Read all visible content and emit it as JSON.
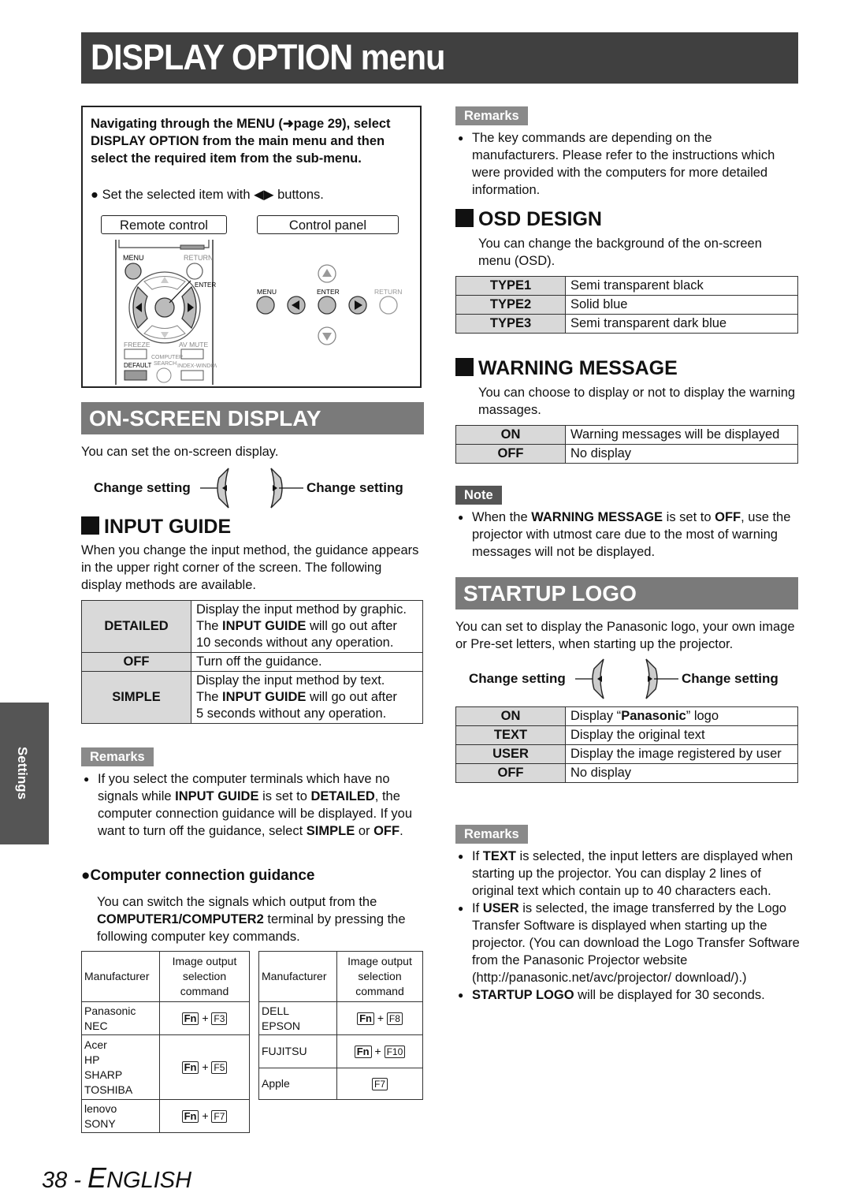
{
  "page_title": "DISPLAY OPTION menu",
  "side_tab": "Settings",
  "nav_box": {
    "instruction": "Navigating through the MENU (➜page 29), select DISPLAY OPTION from the main menu and then select the required item from the sub-menu.",
    "bullet": "Set the selected item with ◀▶ buttons.",
    "remote_label": "Remote control",
    "panel_label": "Control panel",
    "remote_buttons": [
      "MENU",
      "RETURN",
      "ENTER",
      "FREEZE",
      "AV MUTE",
      "COMPUTER SEARCH",
      "DEFAULT",
      "INDEX-WINDOW"
    ],
    "panel_buttons": [
      "MENU",
      "ENTER",
      "RETURN"
    ]
  },
  "on_screen_display": {
    "heading": "ON-SCREEN DISPLAY",
    "intro": "You can set the on-screen display.",
    "change_left": "Change setting",
    "change_right": "Change setting"
  },
  "input_guide": {
    "heading": "INPUT GUIDE",
    "intro": "When you change the input method, the guidance appears in the upper right corner of the screen. The following display methods are available.",
    "rows": [
      {
        "key": "DETAILED",
        "lines": [
          "Display the input method by graphic.",
          "The INPUT GUIDE will go out after",
          "10 seconds without any operation."
        ]
      },
      {
        "key": "OFF",
        "lines": [
          "Turn off the guidance."
        ]
      },
      {
        "key": "SIMPLE",
        "lines": [
          "Display the input method by text.",
          "The INPUT GUIDE will go out after",
          "5 seconds without any operation."
        ]
      }
    ],
    "remarks_label": "Remarks",
    "remarks": "If you select the computer terminals which have no signals while INPUT GUIDE is set to DETAILED, the computer connection guidance will be displayed. If you want to turn off the guidance, select SIMPLE or OFF."
  },
  "computer_guidance": {
    "heading": "Computer connection guidance",
    "intro_a": "You can switch the signals which output from the ",
    "intro_b": "COMPUTER1/COMPUTER2",
    "intro_c": " terminal by pressing the following computer key commands.",
    "col_manufacturer": "Manufacturer",
    "col_command": "Image output selection command",
    "left_table": [
      {
        "makers": [
          "Panasonic",
          "NEC"
        ],
        "fn": "Fn",
        "key": "F3"
      },
      {
        "makers": [
          "Acer",
          "HP",
          "SHARP",
          "TOSHIBA"
        ],
        "fn": "Fn",
        "key": "F5"
      },
      {
        "makers": [
          "lenovo",
          "SONY"
        ],
        "fn": "Fn",
        "key": "F7"
      }
    ],
    "right_table": [
      {
        "makers": [
          "DELL",
          "EPSON"
        ],
        "fn": "Fn",
        "key": "F8"
      },
      {
        "makers": [
          "FUJITSU"
        ],
        "fn": "Fn",
        "key": "F10"
      },
      {
        "makers": [
          "Apple"
        ],
        "fn": "",
        "key": "F7"
      }
    ]
  },
  "right_remarks": {
    "label": "Remarks",
    "text": "The key commands are depending on the manufacturers. Please refer to the instructions which were provided with the computers for more detailed information."
  },
  "osd_design": {
    "heading": "OSD DESIGN",
    "intro": "You can change the background of the on-screen menu (OSD).",
    "rows": [
      {
        "key": "TYPE1",
        "value": "Semi transparent black"
      },
      {
        "key": "TYPE2",
        "value": "Solid blue"
      },
      {
        "key": "TYPE3",
        "value": "Semi transparent dark blue"
      }
    ]
  },
  "warning_message": {
    "heading": "WARNING MESSAGE",
    "intro": "You can choose to display or not to display the warning massages.",
    "rows": [
      {
        "key": "ON",
        "value": "Warning messages will be displayed"
      },
      {
        "key": "OFF",
        "value": "No display"
      }
    ],
    "note_label": "Note",
    "note": "When the WARNING MESSAGE is set to OFF, use the projector with utmost care due to the most of warning messages will not be displayed."
  },
  "startup_logo": {
    "heading": "STARTUP LOGO",
    "intro": "You can set to display the Panasonic logo, your own image or Pre-set letters, when starting up the projector.",
    "change_left": "Change setting",
    "change_right": "Change setting",
    "rows": [
      {
        "key": "ON",
        "value": "Display “Panasonic” logo"
      },
      {
        "key": "TEXT",
        "value": "Display the original text"
      },
      {
        "key": "USER",
        "value": "Display the image registered by user"
      },
      {
        "key": "OFF",
        "value": "No display"
      }
    ],
    "remarks_label": "Remarks",
    "remarks": [
      "If TEXT is selected, the input letters are displayed when starting up the projector. You can display 2 lines of original text which contain up to 40 characters each.",
      "If USER is selected, the image transferred by the Logo Transfer Software is displayed when starting up the projector. (You can download the Logo Transfer Software from the Panasonic Projector website (http://panasonic.net/avc/projector/ download/).)",
      "STARTUP LOGO will be displayed for 30 seconds."
    ]
  },
  "footer": {
    "page_number": "38",
    "separator": " - ",
    "language_initial": "E",
    "language_rest": "NGLISH"
  }
}
